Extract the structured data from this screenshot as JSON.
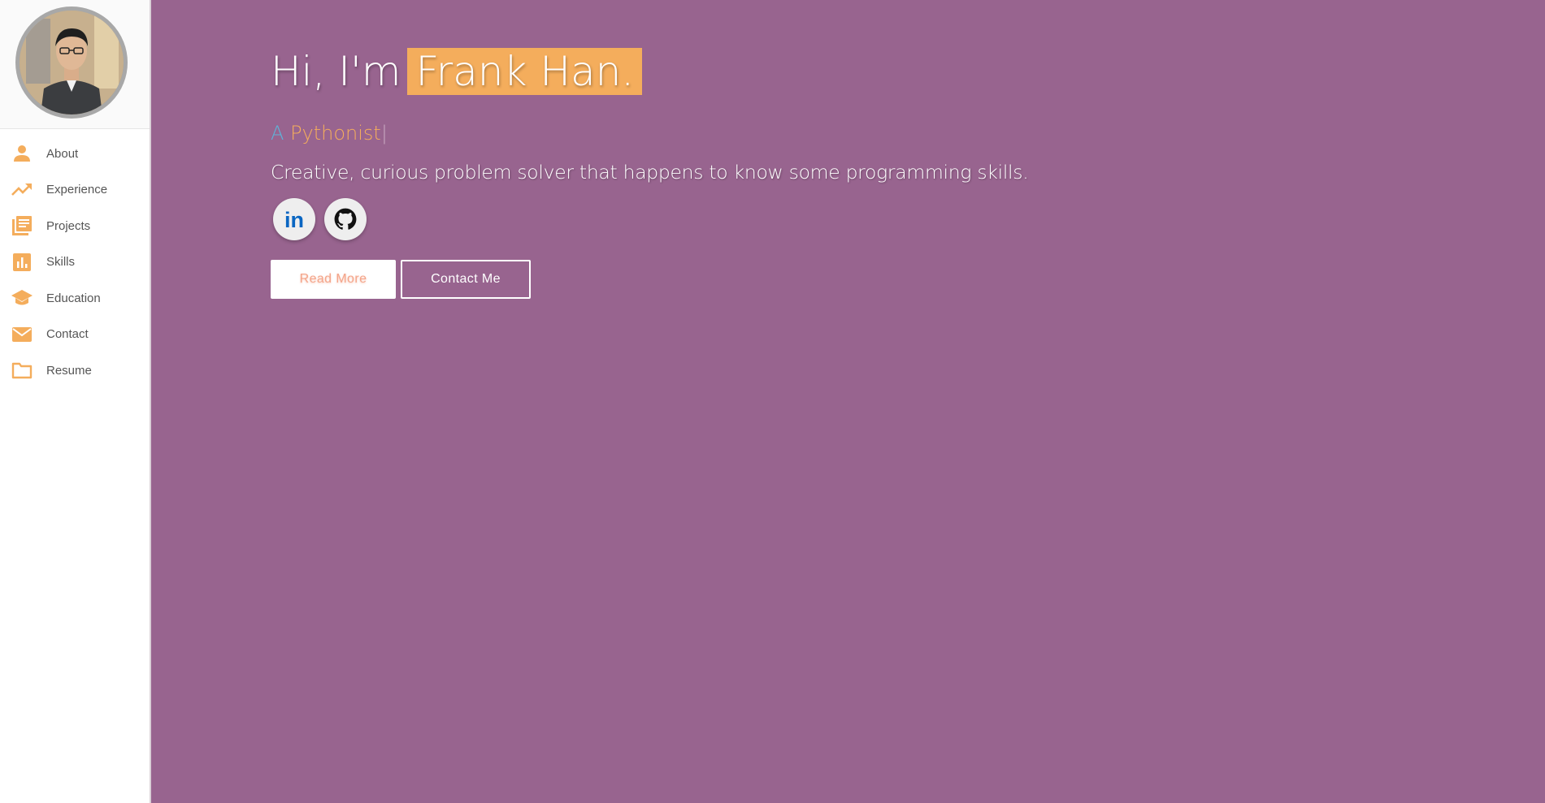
{
  "colors": {
    "background": "#98648f",
    "accent": "#f4ad5c",
    "typed_prefix": "#5fb3d8",
    "button_text": "#f4a58a"
  },
  "sidebar": {
    "avatar_icon": "profile-photo",
    "items": [
      {
        "label": "About",
        "icon": "person-icon"
      },
      {
        "label": "Experience",
        "icon": "trending-up-icon"
      },
      {
        "label": "Projects",
        "icon": "document-list-icon"
      },
      {
        "label": "Skills",
        "icon": "bar-chart-icon"
      },
      {
        "label": "Education",
        "icon": "graduation-cap-icon"
      },
      {
        "label": "Contact",
        "icon": "mail-icon"
      },
      {
        "label": "Resume",
        "icon": "folder-icon"
      }
    ]
  },
  "hero": {
    "greeting": "Hi, I'm",
    "name": "Frank Han.",
    "typed_prefix": "A",
    "typed_word": "Pythonist",
    "cursor": "|",
    "tagline": "Creative, curious problem solver that happens to know some programming skills.",
    "social": [
      {
        "name": "linkedin",
        "icon": "linkedin-icon",
        "text": "in"
      },
      {
        "name": "github",
        "icon": "github-icon"
      }
    ],
    "read_more_label": "Read More",
    "contact_label": "Contact Me"
  }
}
